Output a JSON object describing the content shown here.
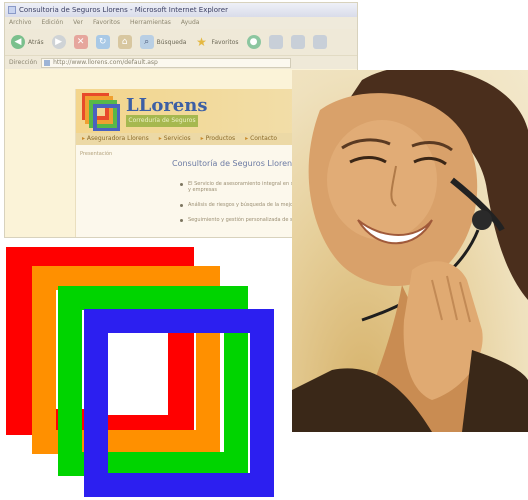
{
  "browser": {
    "title": "Consultoria de Seguros Llorens - Microsoft Internet Explorer",
    "menu": [
      "Archivo",
      "Edición",
      "Ver",
      "Favoritos",
      "Herramientas",
      "Ayuda"
    ],
    "toolbar": {
      "back_label": "Atrás",
      "search_label": "Búsqueda",
      "favorites_label": "Favoritos"
    },
    "address": {
      "label": "Dirección",
      "url": "http://www.llorens.com/default.asp"
    }
  },
  "site": {
    "logo_title": "LLorens",
    "logo_subtitle": "Correduría de Seguros",
    "nav": [
      "Aseguradora Llorens",
      "Servicios",
      "Productos",
      "Contacto"
    ],
    "left_link": "Presentación",
    "heading": "Consultoría de Seguros Llorens",
    "bullets": [
      "El Servicio de asesoramiento integral en seguros a particulares y empresas",
      "Análisis de riesgos y búsqueda de la mejor opción",
      "Seguimiento y gestión personalizada de siniestros"
    ]
  },
  "colors": {
    "logo_red": "#ff0000",
    "logo_orange": "#ff9000",
    "logo_green": "#00d400",
    "logo_blue": "#2c1ff0"
  }
}
